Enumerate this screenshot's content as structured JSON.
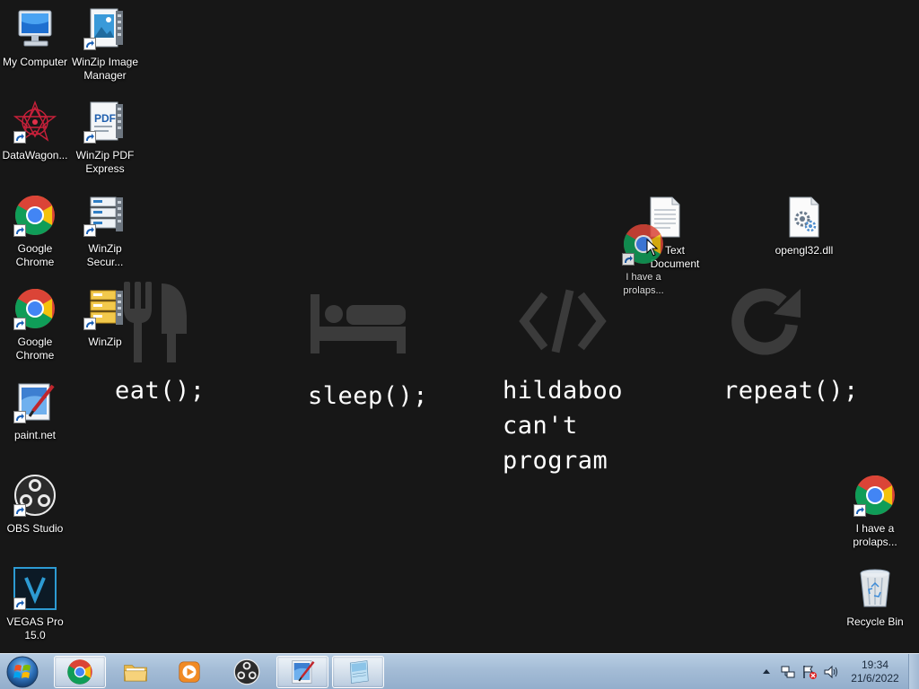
{
  "wallpaper": {
    "texts": {
      "eat": "eat();",
      "sleep": "sleep();",
      "code": "hildaboo\ncan't\nprogram",
      "repeat": "repeat();"
    },
    "glyph_icons": [
      "fork-knife-icon",
      "bed-icon",
      "code-icon",
      "refresh-icon"
    ],
    "glyph_color": "#3b3b3b"
  },
  "desktop_icons": {
    "my_computer": {
      "label": "My Computer",
      "icon": "computer-icon"
    },
    "winzip_image": {
      "label": "WinZip Image Manager",
      "icon": "winzip-image-manager-icon"
    },
    "datawagon": {
      "label": "DataWagon...",
      "icon": "datawagon-icon"
    },
    "winzip_pdf": {
      "label": "WinZip PDF Express",
      "icon": "winzip-pdf-icon"
    },
    "chrome1": {
      "label": "Google Chrome",
      "icon": "chrome-icon"
    },
    "winzip_secure": {
      "label": "WinZip Secur...",
      "icon": "winzip-secure-icon"
    },
    "chrome2": {
      "label": "Google Chrome",
      "icon": "chrome-icon"
    },
    "winzip": {
      "label": "WinZip",
      "icon": "winzip-icon"
    },
    "paintnet": {
      "label": "paint.net",
      "icon": "paintnet-icon"
    },
    "obs": {
      "label": "OBS Studio",
      "icon": "obs-icon"
    },
    "vegas": {
      "label": "VEGAS Pro 15.0",
      "icon": "vegas-icon"
    },
    "text_doc": {
      "label": "Text Document",
      "icon": "text-document-icon"
    },
    "dragged_chrome": {
      "label": "I have a prolaps...",
      "icon": "chrome-icon"
    },
    "opengl": {
      "label": "opengl32.dll",
      "icon": "dll-file-icon"
    },
    "chrome3": {
      "label": "I have a prolaps...",
      "icon": "chrome-icon"
    },
    "recycle_bin": {
      "label": "Recycle Bin",
      "icon": "recycle-bin-icon"
    }
  },
  "taskbar": {
    "start_icon": "windows-start-orb-icon",
    "pinned": [
      {
        "name": "chrome",
        "icon": "chrome-icon",
        "active": true
      },
      {
        "name": "explorer",
        "icon": "folder-icon",
        "active": false
      },
      {
        "name": "media-player",
        "icon": "media-player-icon",
        "active": false
      },
      {
        "name": "obs",
        "icon": "obs-icon",
        "active": false
      },
      {
        "name": "paintnet",
        "icon": "paintnet-icon",
        "active": true
      },
      {
        "name": "notepad",
        "icon": "notepad-icon",
        "active": true
      }
    ],
    "clock": {
      "time": "19:34",
      "date": "21/6/2022"
    }
  },
  "colors": {
    "desktop_bg": "#171717",
    "taskbar": "#a4bcd6",
    "chrome_red": "#db4437",
    "chrome_yellow": "#f4c20d",
    "chrome_green": "#0f9d58",
    "chrome_blue": "#4285f4"
  }
}
